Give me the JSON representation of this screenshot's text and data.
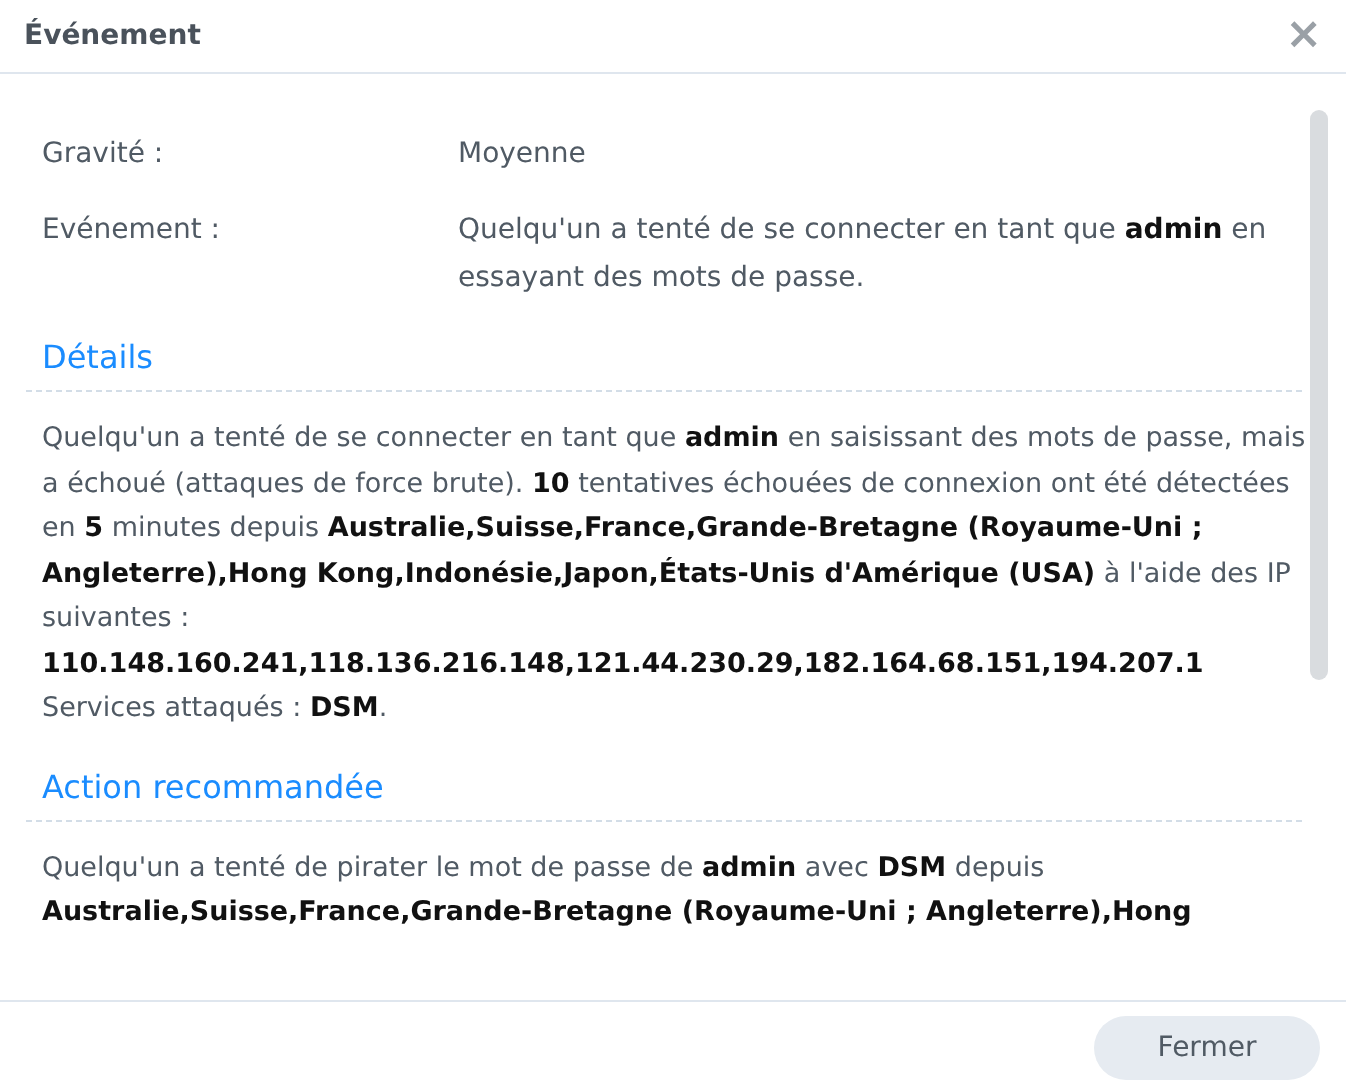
{
  "window": {
    "title": "Événement",
    "close": "×"
  },
  "fields": [
    {
      "label": "Gravité :",
      "value": "Moyenne"
    },
    {
      "label": "Evénement :",
      "value": "Quelqu'un a tenté de se connecter en tant que **admin** en essayant des mots de passe."
    }
  ],
  "sections": [
    {
      "title": "Détails",
      "paragraphs": [
        "Quelqu'un a tenté de se connecter en tant que **admin** en saisissant des mots de passe, mais a échoué (attaques de force brute). **10** tentatives échouées de connexion ont été détectées en **5** minutes depuis **Australie,Suisse,France,Grande-Bretagne (Royaume-Uni ; Angleterre),Hong Kong,Indonésie,Japon,États-Unis d'Amérique (USA)** à l'aide des IP suivantes : **110.148.160.241,118.136.216.148,121.44.230.29,182.164.68.151,194.207.1** Services attaqués : **DSM**."
      ]
    },
    {
      "title": "Action recommandée",
      "paragraphs": [
        "Quelqu'un a tenté de pirater le mot de passe de **admin** avec **DSM** depuis **Australie,Suisse,France,Grande-Bretagne (Royaume-Uni ; Angleterre),Hong**"
      ]
    }
  ],
  "buttons": [
    "Fermer"
  ]
}
